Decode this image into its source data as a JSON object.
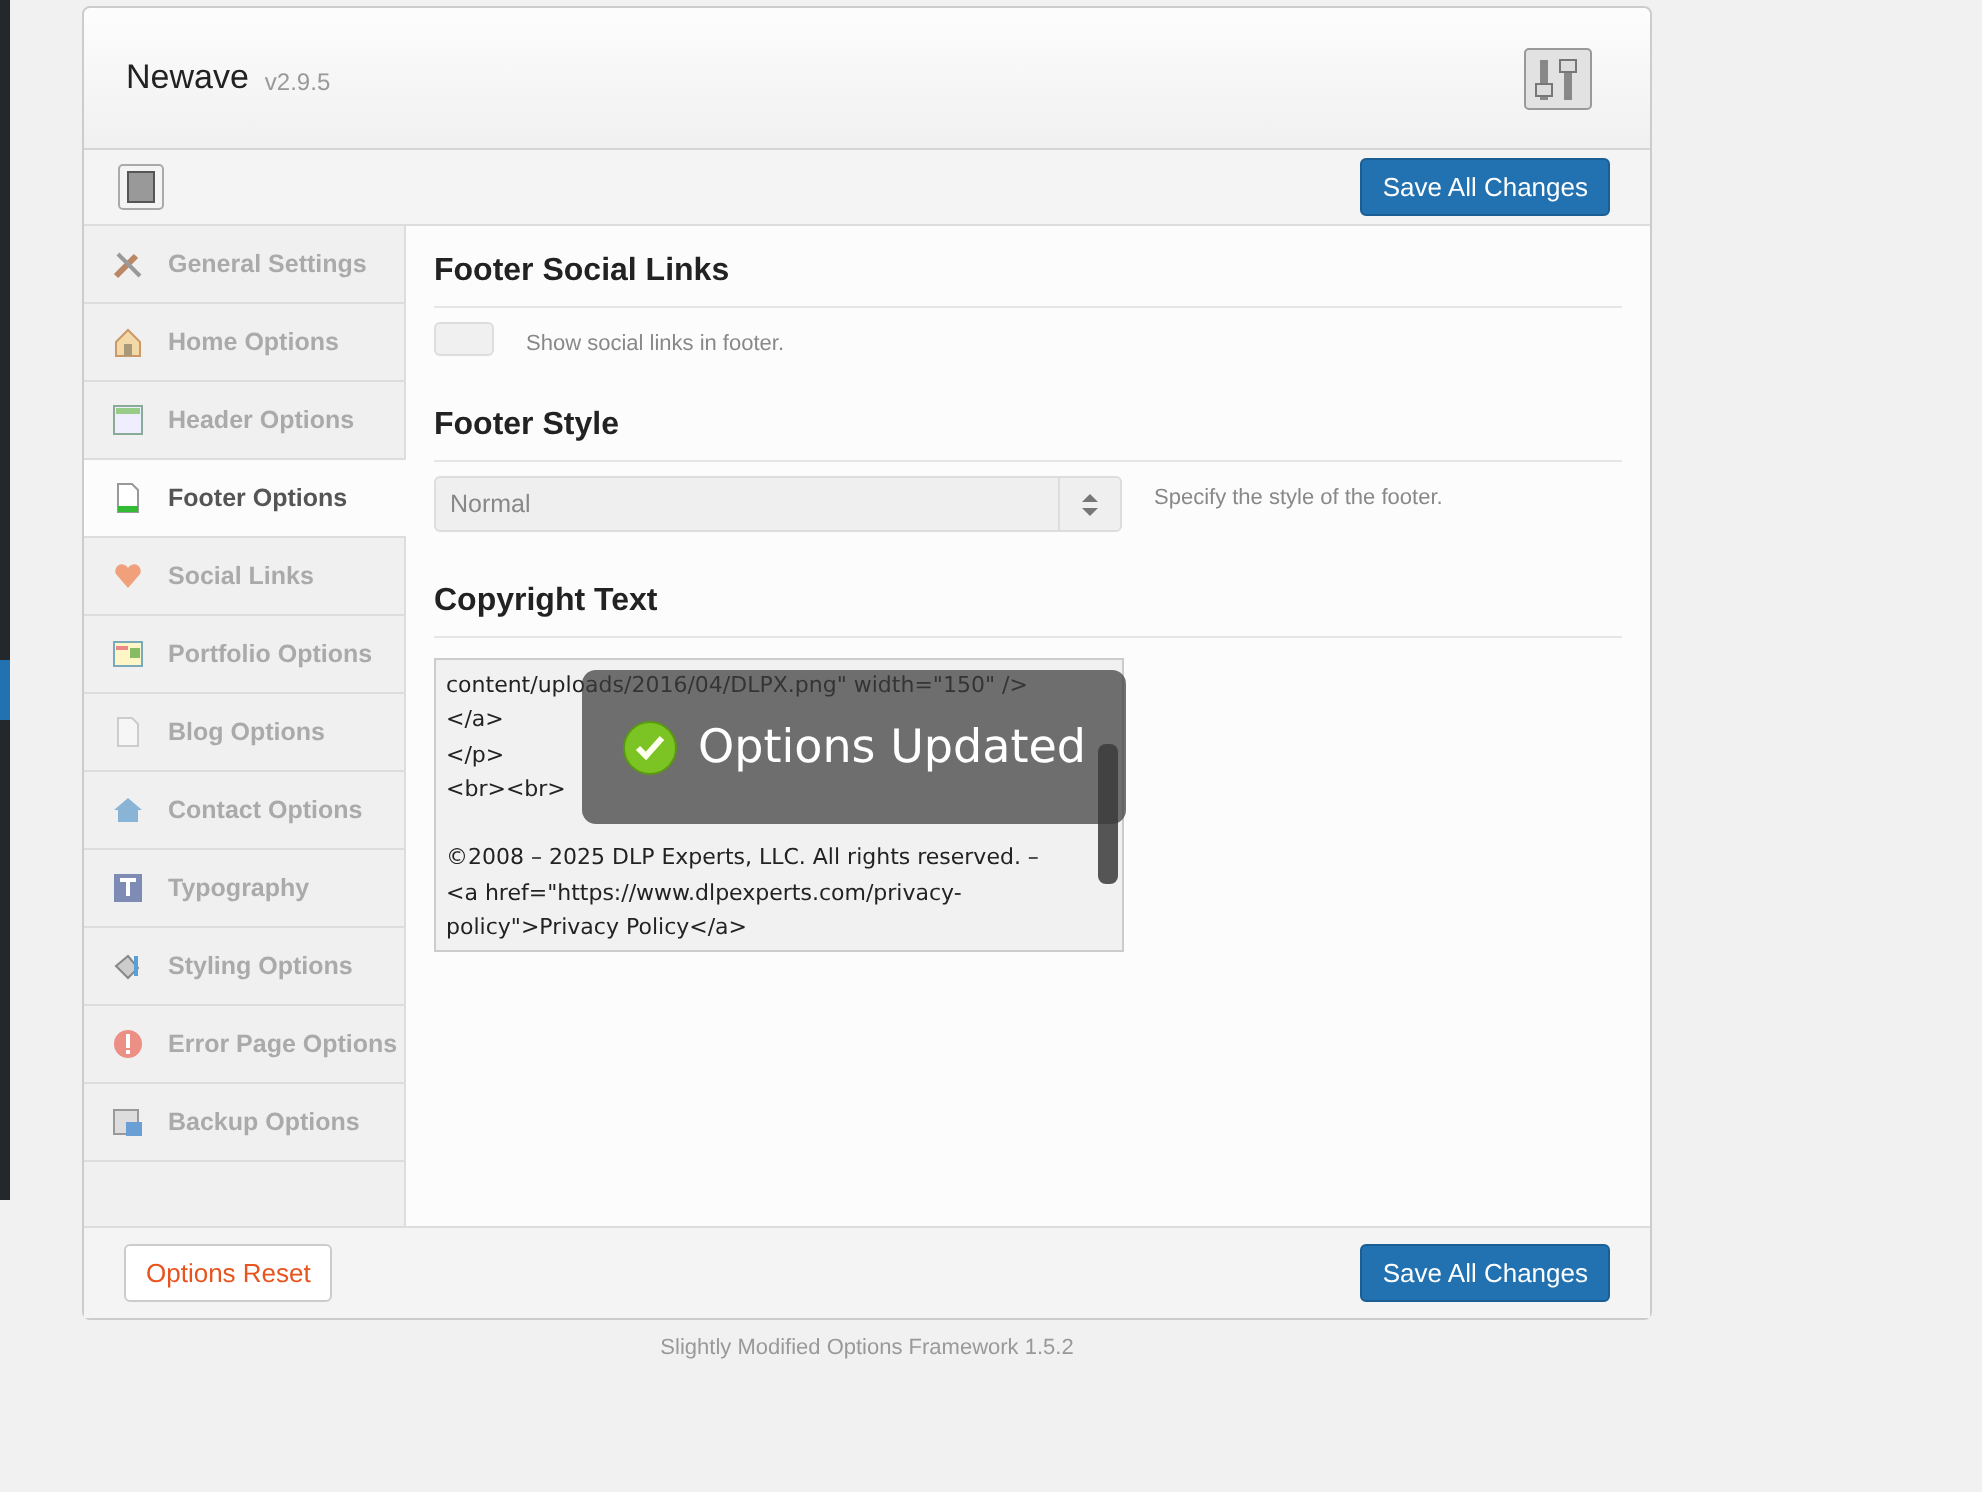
{
  "header": {
    "title": "Newave",
    "version": "v2.9.5"
  },
  "toolbar": {
    "save_button": "Save All Changes"
  },
  "sidebar": {
    "items": [
      {
        "label": "General Settings",
        "selected": false
      },
      {
        "label": "Home Options",
        "selected": false
      },
      {
        "label": "Header Options",
        "selected": false
      },
      {
        "label": "Footer Options",
        "selected": true
      },
      {
        "label": "Social Links",
        "selected": false
      },
      {
        "label": "Portfolio Options",
        "selected": false
      },
      {
        "label": "Blog Options",
        "selected": false
      },
      {
        "label": "Contact Options",
        "selected": false
      },
      {
        "label": "Typography",
        "selected": false
      },
      {
        "label": "Styling Options",
        "selected": false
      },
      {
        "label": "Error Page Options",
        "selected": false
      },
      {
        "label": "Backup Options",
        "selected": false
      }
    ]
  },
  "sections": [
    {
      "kind": "toggle",
      "heading": "Footer Social Links",
      "on": false,
      "description": "Show social links in footer."
    },
    {
      "kind": "select",
      "heading": "Footer Style",
      "value": "Normal",
      "description": "Specify the style of the footer."
    },
    {
      "kind": "textarea",
      "heading": "Copyright Text",
      "value": "content/uploads/2016/04/DLPX.png\" width=\"150\" />\n</a>\n</p>\n<br><br>\n\n©2008 – 2025 DLP Experts, LLC. All rights reserved. –\n<a href=\"https://www.dlpexperts.com/privacy-\npolicy\">Privacy Policy</a>"
    }
  ],
  "toast": {
    "text": "Options Updated"
  },
  "footer": {
    "reset_button": "Options Reset",
    "save_button": "Save All Changes"
  },
  "credit": "Slightly Modified Options Framework 1.5.2"
}
